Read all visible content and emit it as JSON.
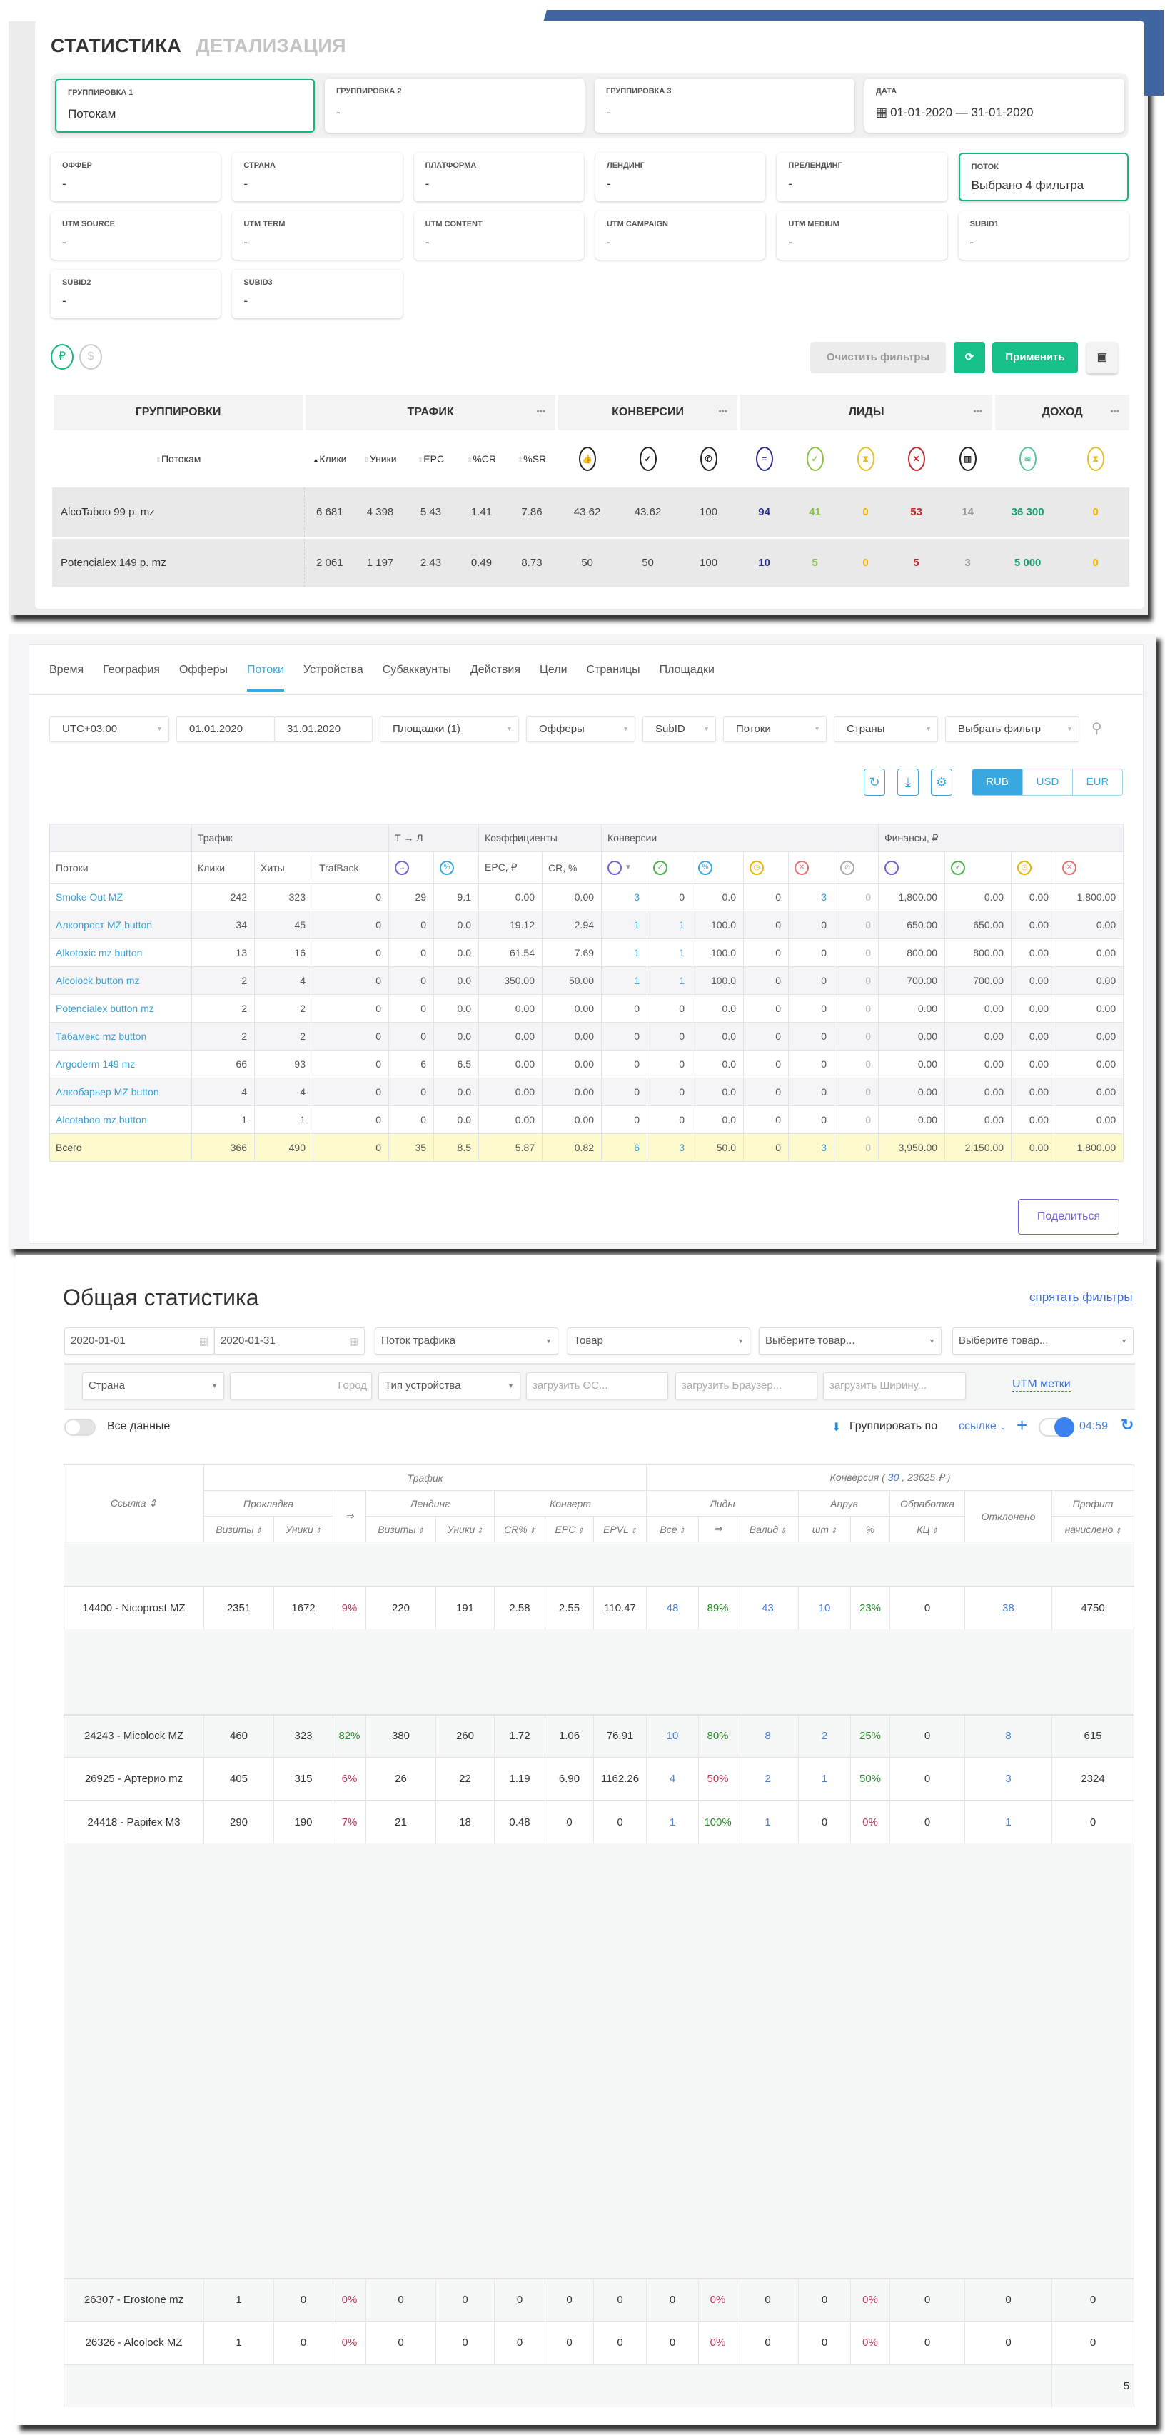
{
  "panel1": {
    "tabs": [
      "СТАТИСТИКА",
      "ДЕТАЛИЗАЦИЯ"
    ],
    "groupings": [
      {
        "label": "ГРУППИРОВКА 1",
        "value": "Потокам"
      },
      {
        "label": "ГРУППИРОВКА 2",
        "value": "-"
      },
      {
        "label": "ГРУППИРОВКА 3",
        "value": "-"
      },
      {
        "label": "ДАТА",
        "value": "01-01-2020 — 31-01-2020"
      }
    ],
    "filters": [
      {
        "label": "ОФФЕР",
        "value": "-"
      },
      {
        "label": "СТРАНА",
        "value": "-"
      },
      {
        "label": "ПЛАТФОРМА",
        "value": "-"
      },
      {
        "label": "ЛЕНДИНГ",
        "value": "-"
      },
      {
        "label": "ПРЕЛЕНДИНГ",
        "value": "-"
      },
      {
        "label": "ПОТОК",
        "value": "Выбрано 4 фильтра"
      },
      {
        "label": "UTM SOURCE",
        "value": "-"
      },
      {
        "label": "UTM TERM",
        "value": "-"
      },
      {
        "label": "UTM CONTENT",
        "value": "-"
      },
      {
        "label": "UTM CAMPAIGN",
        "value": "-"
      },
      {
        "label": "UTM MEDIUM",
        "value": "-"
      },
      {
        "label": "SUBID1",
        "value": "-"
      },
      {
        "label": "SUBID2",
        "value": "-"
      },
      {
        "label": "SUBID3",
        "value": "-"
      }
    ],
    "currencies": [
      "₽",
      "$"
    ],
    "clear_label": "Очистить фильтры",
    "apply_label": "Применить",
    "groups": [
      "ГРУППИРОВКИ",
      "ТРАФИК",
      "КОНВЕРСИИ",
      "ЛИДЫ",
      "ДОХОД"
    ],
    "subheads": [
      "Потокам",
      "Клики",
      "Уники",
      "EPC",
      "%CR",
      "%SR"
    ],
    "icon_heads": [
      {
        "icon": "thumb-percent-icon",
        "g": "👍",
        "c": "#222"
      },
      {
        "icon": "check-percent-icon",
        "g": "✓",
        "c": "#222"
      },
      {
        "icon": "phone-percent-icon",
        "g": "✆",
        "c": "#222"
      },
      {
        "icon": "equals-icon",
        "g": "=",
        "c": "#2b2e8c"
      },
      {
        "icon": "check-icon",
        "g": "✓",
        "c": "#8bc34a"
      },
      {
        "icon": "hourglass-icon",
        "g": "⧗",
        "c": "#e6c02a"
      },
      {
        "icon": "cross-icon",
        "g": "✕",
        "c": "#c0282d"
      },
      {
        "icon": "trash-icon",
        "g": "▥",
        "c": "#222"
      },
      {
        "icon": "money-icon",
        "g": "≋",
        "c": "#5cc0a0"
      },
      {
        "icon": "hourglass-icon",
        "g": "⧗",
        "c": "#e6c02a"
      }
    ],
    "rows": [
      {
        "name": "AlcoTaboo 99 р. mz",
        "vals": [
          "6 681",
          "4 398",
          "5.43",
          "1.41",
          "7.86",
          "43.62",
          "43.62",
          "100",
          "94",
          "41",
          "0",
          "53",
          "14",
          "36 300",
          "0"
        ]
      },
      {
        "name": "Potencialex 149 р. mz",
        "vals": [
          "2 061",
          "1 197",
          "2.43",
          "0.49",
          "8.73",
          "50",
          "50",
          "100",
          "10",
          "5",
          "0",
          "5",
          "3",
          "5 000",
          "0"
        ]
      }
    ],
    "value_colors": [
      "#444",
      "#444",
      "#444",
      "#444",
      "#444",
      "#444",
      "#444",
      "#444",
      "#2b2e8c",
      "#8bc34a",
      "#f0b400",
      "#c0282d",
      "#999",
      "#1a9e6e",
      "#f0b400"
    ]
  },
  "panel2": {
    "tabs": [
      "Время",
      "География",
      "Офферы",
      "Потоки",
      "Устройства",
      "Субаккаунты",
      "Действия",
      "Цели",
      "Страницы",
      "Площадки"
    ],
    "active_tab": "Потоки",
    "filters": {
      "timezone": "UTC+03:00",
      "date_from": "01.01.2020",
      "date_to": "31.01.2020",
      "sites": "Площадки (1)",
      "offers": "Офферы",
      "subid": "SubID",
      "streams": "Потоки",
      "countries": "Страны",
      "choose": "Выбрать фильтр"
    },
    "currencies": [
      "RUB",
      "USD",
      "EUR"
    ],
    "active_currency": "RUB",
    "group_heads": [
      "",
      "Трафик",
      "Т → Л",
      "Коэффициенты",
      "Конверсии",
      "Финансы, ₽"
    ],
    "col_heads": [
      "Потоки",
      "Клики",
      "Хиты",
      "TrafBack",
      "EPC, ₽",
      "CR, %"
    ],
    "rows": [
      [
        "Smoke Out MZ",
        "242",
        "323",
        "0",
        "29",
        "9.1",
        "0.00",
        "0.00",
        "3",
        "0",
        "0.0",
        "0",
        "3",
        "0",
        "1,800.00",
        "0.00",
        "0.00",
        "1,800.00"
      ],
      [
        "Алкопрост MZ button",
        "34",
        "45",
        "0",
        "0",
        "0.0",
        "19.12",
        "2.94",
        "1",
        "1",
        "100.0",
        "0",
        "0",
        "0",
        "650.00",
        "650.00",
        "0.00",
        "0.00"
      ],
      [
        "Alkotoxic mz button",
        "13",
        "16",
        "0",
        "0",
        "0.0",
        "61.54",
        "7.69",
        "1",
        "1",
        "100.0",
        "0",
        "0",
        "0",
        "800.00",
        "800.00",
        "0.00",
        "0.00"
      ],
      [
        "Alcolock button mz",
        "2",
        "4",
        "0",
        "0",
        "0.0",
        "350.00",
        "50.00",
        "1",
        "1",
        "100.0",
        "0",
        "0",
        "0",
        "700.00",
        "700.00",
        "0.00",
        "0.00"
      ],
      [
        "Potencialex button mz",
        "2",
        "2",
        "0",
        "0",
        "0.0",
        "0.00",
        "0.00",
        "0",
        "0",
        "0.0",
        "0",
        "0",
        "0",
        "0.00",
        "0.00",
        "0.00",
        "0.00"
      ],
      [
        "Табамекс mz button",
        "2",
        "2",
        "0",
        "0",
        "0.0",
        "0.00",
        "0.00",
        "0",
        "0",
        "0.0",
        "0",
        "0",
        "0",
        "0.00",
        "0.00",
        "0.00",
        "0.00"
      ],
      [
        "Argoderm 149 mz",
        "66",
        "93",
        "0",
        "6",
        "6.5",
        "0.00",
        "0.00",
        "0",
        "0",
        "0.0",
        "0",
        "0",
        "0",
        "0.00",
        "0.00",
        "0.00",
        "0.00"
      ],
      [
        "Алкобарьер MZ button",
        "4",
        "4",
        "0",
        "0",
        "0.0",
        "0.00",
        "0.00",
        "0",
        "0",
        "0.0",
        "0",
        "0",
        "0",
        "0.00",
        "0.00",
        "0.00",
        "0.00"
      ],
      [
        "Alcotaboo mz button",
        "1",
        "1",
        "0",
        "0",
        "0.0",
        "0.00",
        "0.00",
        "0",
        "0",
        "0.0",
        "0",
        "0",
        "0",
        "0.00",
        "0.00",
        "0.00",
        "0.00"
      ]
    ],
    "total": [
      "Всего",
      "366",
      "490",
      "0",
      "35",
      "8.5",
      "5.87",
      "0.82",
      "6",
      "3",
      "50.0",
      "0",
      "3",
      "0",
      "3,950.00",
      "2,150.00",
      "0.00",
      "1,800.00"
    ],
    "share_label": "Поделиться"
  },
  "panel3": {
    "title": "Общая статистика",
    "hide_filters": "спрятать фильтры",
    "date_from": "2020-01-01",
    "date_to": "2020-01-31",
    "selects": [
      "Поток трафика",
      "Товар",
      "Выберите товар...",
      "Выберите товар..."
    ],
    "sub_filters": {
      "country": "Страна",
      "city": "Город",
      "device": "Тип устройства",
      "os": "загрузить ОС...",
      "browser": "загрузить Браузер...",
      "width": "загрузить Ширину...",
      "utm": "UTM метки"
    },
    "all_data": "Все данные",
    "group_by": "Группировать по",
    "group_value": "ссылке",
    "timer": "04:59",
    "head": {
      "link": "Ссылка",
      "traffic": "Трафик",
      "conv_prefix": "Конверсия (",
      "conv_count": "30",
      "conv_suffix": ", 23625 ₽ )",
      "prokladka": "Прокладка",
      "landing": "Лендинг",
      "convert": "Конверт",
      "leads": "Лиды",
      "approve": "Апрув",
      "processing": "Обработка",
      "rejected": "Отклонено",
      "profit": "Профит",
      "arrow": "⇒",
      "sub": [
        "Визиты",
        "Уники",
        "Визиты",
        "Уники",
        "CR%",
        "EPC",
        "EPVL",
        "Все",
        "⇒",
        "Валид",
        "шт",
        "%",
        "КЦ",
        "начислено"
      ]
    },
    "rows": [
      [
        "14400 - Nicoprost MZ",
        "2351",
        "1672",
        "9%",
        "220",
        "191",
        "2.58",
        "2.55",
        "110.47",
        "48",
        "89%",
        "43",
        "10",
        "23%",
        "0",
        "38",
        "4750"
      ],
      [
        "24243 - Micolock MZ",
        "460",
        "323",
        "82%",
        "380",
        "260",
        "1.72",
        "1.06",
        "76.91",
        "10",
        "80%",
        "8",
        "2",
        "25%",
        "0",
        "8",
        "615"
      ],
      [
        "26925 - Артерио mz",
        "405",
        "315",
        "6%",
        "26",
        "22",
        "1.19",
        "6.90",
        "1162.26",
        "4",
        "50%",
        "2",
        "1",
        "50%",
        "0",
        "3",
        "2324"
      ],
      [
        "24418 - Papifex M3",
        "290",
        "190",
        "7%",
        "21",
        "18",
        "0.48",
        "0",
        "0",
        "1",
        "100%",
        "1",
        "0",
        "0%",
        "0",
        "1",
        "0"
      ],
      [
        "26307 - Erostone mz",
        "1",
        "0",
        "0%",
        "0",
        "0",
        "0",
        "0",
        "0",
        "0",
        "0%",
        "0",
        "0",
        "0%",
        "0",
        "0",
        "0"
      ],
      [
        "26326 - Alcolock MZ",
        "1",
        "0",
        "0%",
        "0",
        "0",
        "0",
        "0",
        "0",
        "0",
        "0%",
        "0",
        "0",
        "0%",
        "0",
        "0",
        "0"
      ]
    ],
    "footer_value": "5"
  }
}
